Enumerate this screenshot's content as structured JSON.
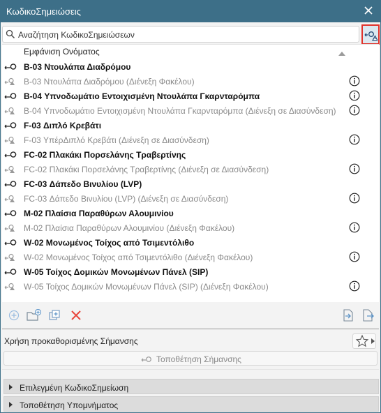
{
  "window": {
    "title": "ΚωδικοΣημειώσεις"
  },
  "search": {
    "placeholder": "Αναζήτηση ΚωδικοΣημειώσεων"
  },
  "list": {
    "column_header": "Εμφάνιση Ονόματος",
    "rows": [
      {
        "label": "B-03 Ντουλάπα Διαδρόμου",
        "style": "bold",
        "info": false
      },
      {
        "label": "B-03 Ντουλάπα Διαδρόμου (Διένεξη Φακέλου)",
        "style": "dim",
        "info": true
      },
      {
        "label": "B-04 Υπνοδωμάτιο Εντοιχισμένη Ντουλάπα Γκαρνταρόμπα",
        "style": "bold",
        "info": true
      },
      {
        "label": "B-04 Υπνοδωμάτιο Εντοιχισμένη Ντουλάπα Γκαρνταρόμπα (Διένεξη σε Διασύνδεση)",
        "style": "dim",
        "info": true
      },
      {
        "label": "F-03 Διπλό Κρεβάτι",
        "style": "bold",
        "info": false
      },
      {
        "label": "F-03 ΥπέρΔιπλό Κρεβάτι (Διένεξη σε Διασύνδεση)",
        "style": "dim",
        "info": true
      },
      {
        "label": "FC-02 Πλακάκι Πορσελάνης Τραβερτίνης",
        "style": "bold",
        "info": false
      },
      {
        "label": "FC-02 Πλακάκι Πορσελάνης Τραβερτίνης (Διένεξη σε Διασύνδεση)",
        "style": "dim",
        "info": true
      },
      {
        "label": "FC-03 Δάπεδο Βινυλίου (LVP)",
        "style": "bold",
        "info": false
      },
      {
        "label": "FC-03 Δάπεδο Βινυλίου (LVP) (Διένεξη σε Διασύνδεση)",
        "style": "dim",
        "info": true
      },
      {
        "label": "M-02 Πλαίσια Παραθύρων Αλουμινίου",
        "style": "bold",
        "info": false
      },
      {
        "label": "M-02 Πλαίσια Παραθύρων Αλουμινίου (Διένεξη Φακέλου)",
        "style": "dim",
        "info": true
      },
      {
        "label": "W-02 Μονωμένος Τοίχος από Τσιμεντόλιθο",
        "style": "bold",
        "info": false
      },
      {
        "label": "W-02 Μονωμένος Τοίχος από Τσιμεντόλιθο (Διένεξη Φακέλου)",
        "style": "dim",
        "info": true
      },
      {
        "label": "W-05 Τοίχος Δομικών Μονωμένων Πάνελ (SIP)",
        "style": "bold",
        "info": false
      },
      {
        "label": "W-05 Τοίχος Δομικών Μονωμένων Πάνελ (SIP) (Διένεξη Φακέλου)",
        "style": "dim",
        "info": true
      }
    ]
  },
  "preset": {
    "label": "Χρήση προκαθορισμένης Σήμανσης"
  },
  "place_button": {
    "label": "Τοποθέτηση Σήμανσης"
  },
  "sections": [
    {
      "label": "Επιλεγμένη ΚωδικοΣημείωση"
    },
    {
      "label": "Τοποθέτηση Υπομνήματος"
    }
  ],
  "colors": {
    "titlebar": "#3d6f88",
    "highlight_border": "#e0322b",
    "delete_red": "#e8473d",
    "icon_blue": "#5b93c7"
  }
}
